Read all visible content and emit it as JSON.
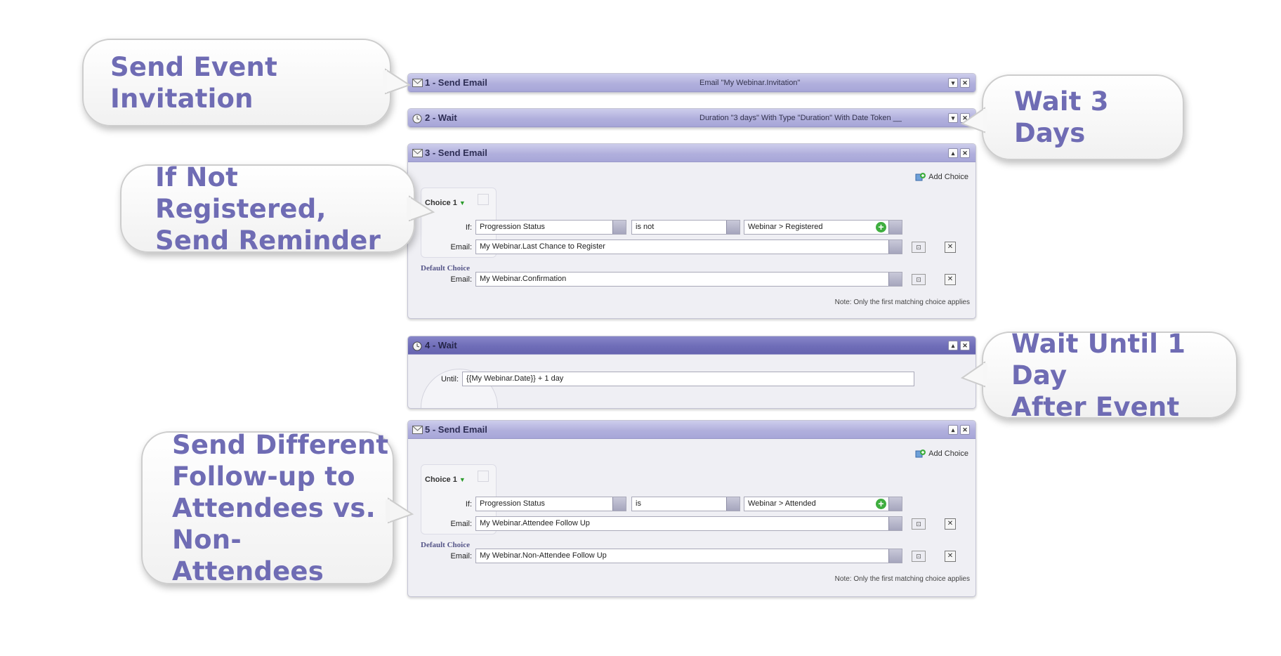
{
  "callouts": {
    "invite": {
      "lines": [
        "Send Event Invitation"
      ]
    },
    "wait3": {
      "lines": [
        "Wait 3 Days"
      ]
    },
    "reminder": {
      "lines": [
        "If Not Registered,",
        "Send Reminder"
      ]
    },
    "wait_until": {
      "lines": [
        "Wait Until 1 Day",
        "After Event"
      ]
    },
    "followup": {
      "lines": [
        "Send Different",
        "Follow-up to",
        "Attendees vs.",
        "Non-Attendees"
      ]
    }
  },
  "steps": {
    "s1": {
      "title": "1 - Send Email",
      "desc": "Email \"My Webinar.Invitation\""
    },
    "s2": {
      "title": "2 - Wait",
      "desc": "Duration \"3 days\" With Type \"Duration\" With Date Token __"
    },
    "s3": {
      "title": "3 - Send Email",
      "add_choice": "Add Choice",
      "choice_label": "Choice 1",
      "if_label": "If:",
      "condition_field": "Progression Status",
      "operator": "is not",
      "value": "Webinar > Registered",
      "email_label": "Email:",
      "email_value": "My Webinar.Last Chance to Register",
      "default_choice": "Default Choice",
      "default_email": "My Webinar.Confirmation",
      "note": "Note: Only the first matching choice applies"
    },
    "s4": {
      "title": "4 - Wait",
      "until_label": "Until:",
      "until_value": "{{My Webinar.Date}} + 1 day"
    },
    "s5": {
      "title": "5 - Send Email",
      "add_choice": "Add Choice",
      "choice_label": "Choice 1",
      "if_label": "If:",
      "condition_field": "Progression Status",
      "operator": "is",
      "value": "Webinar > Attended",
      "email_label": "Email:",
      "email_value": "My Webinar.Attendee Follow Up",
      "default_choice": "Default Choice",
      "default_email": "My Webinar.Non-Attendee Follow Up",
      "note": "Note: Only the first matching choice applies"
    }
  },
  "colors": {
    "callout_text": "#6f6cb4",
    "header": "#b1b0dd",
    "header_active": "#6f6db8",
    "add_green": "#3fae3f"
  }
}
